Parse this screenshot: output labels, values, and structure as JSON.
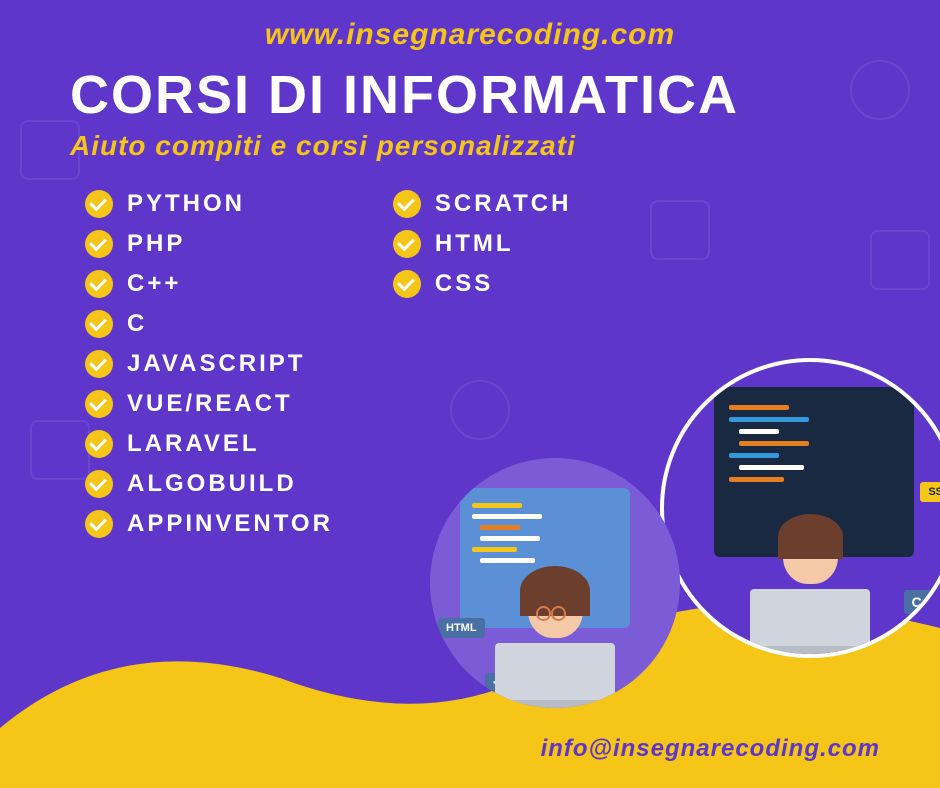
{
  "website": "www.insegnarecoding.com",
  "title": "CORSI DI INFORMATICA",
  "subtitle": "Aiuto compiti e corsi personalizzati",
  "email": "info@insegnarecoding.com",
  "col1": [
    "PYTHON",
    "PHP",
    "C++",
    "C",
    "JAVASCRIPT",
    "VUE/REACT",
    "LARAVEL",
    "ALGOBUILD",
    "APPINVENTOR"
  ],
  "col2": [
    "SCRATCH",
    "HTML",
    "CSS"
  ],
  "illus_tags": {
    "left1": "HTML",
    "left2": "<code>",
    "right1": "SS",
    "right2": "C++"
  },
  "colors": {
    "bg": "#5E36C9",
    "accent": "#F5C518",
    "text": "#FFFFFF"
  }
}
